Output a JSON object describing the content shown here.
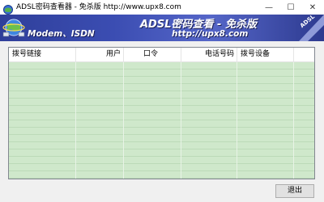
{
  "window": {
    "title": "ADSL密码查看器 - 免杀版  http://www.upx8.com",
    "controls": {
      "minimize": "—",
      "maximize": "☐",
      "close": "✕"
    }
  },
  "banner": {
    "main_text": "ADSL密码查看 - 免杀版",
    "left_text": "Modem、ISDN",
    "url_text": "http://upx8.com",
    "corner_text": "ADSL",
    "colors": {
      "background": "#3b4db2",
      "text": "#ffffff"
    }
  },
  "table": {
    "columns": [
      "拨号链接",
      "用户",
      "口令",
      "电话号码",
      "拨号设备",
      ""
    ],
    "rows": [],
    "row_color": "#cfe8cb"
  },
  "buttons": {
    "exit": "退出"
  }
}
